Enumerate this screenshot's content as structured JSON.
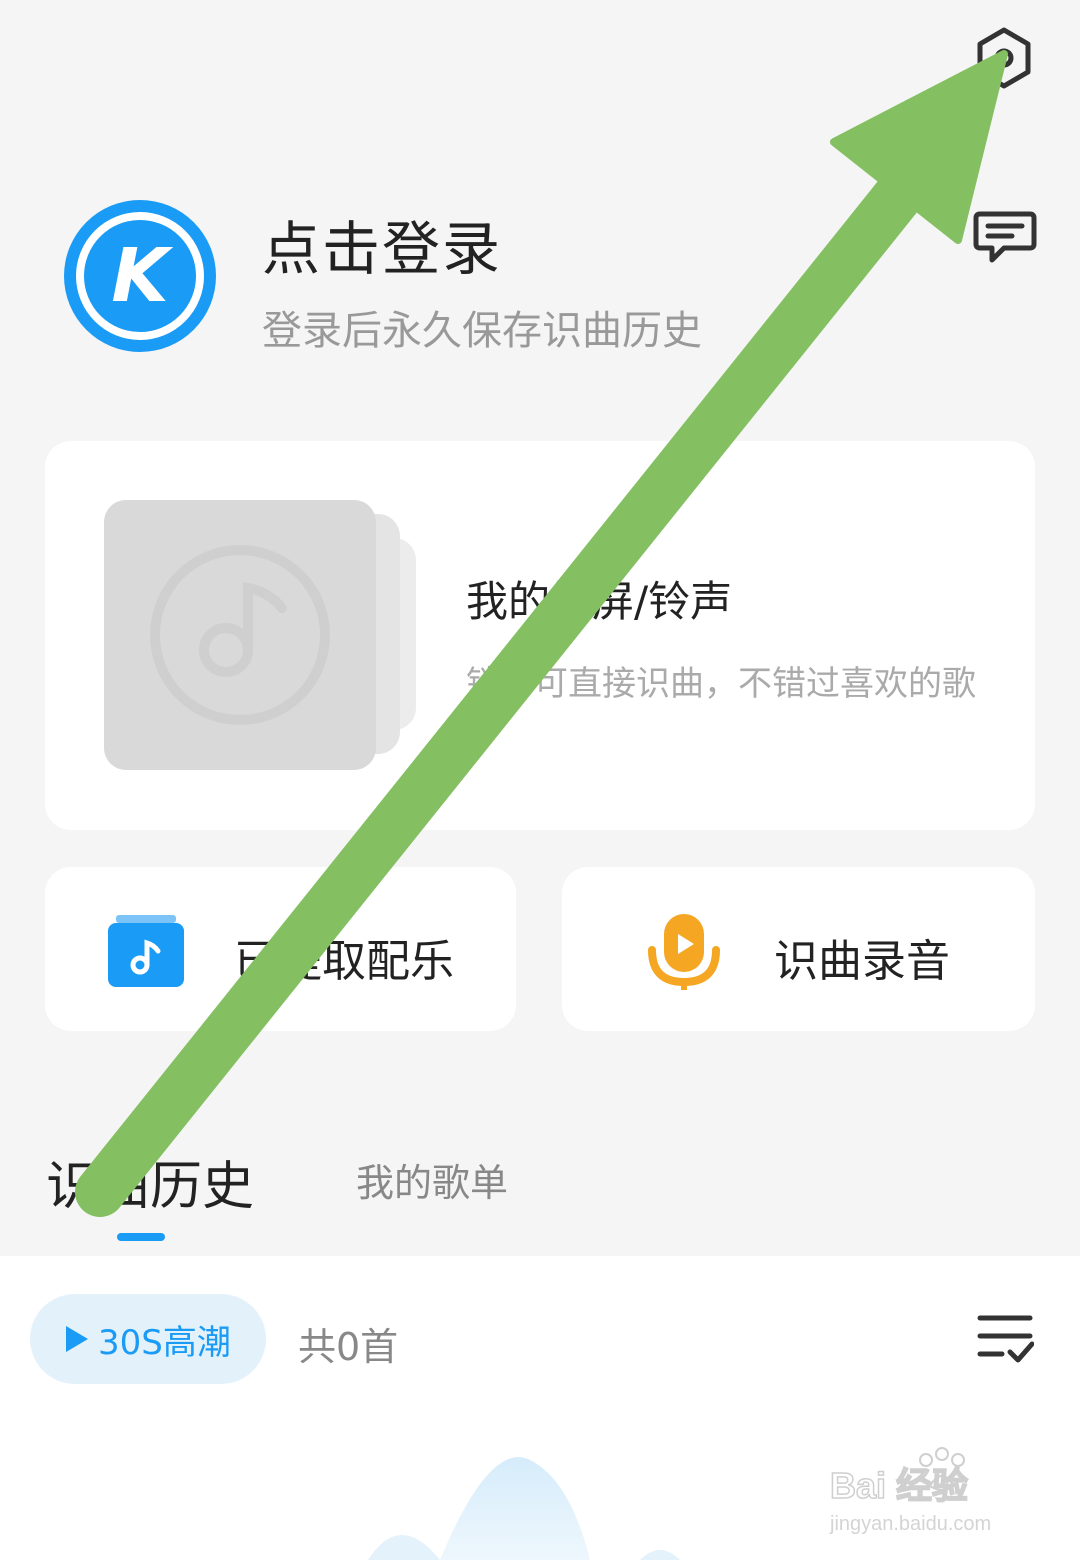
{
  "header": {
    "settings_icon": "settings-hexagon-icon",
    "feedback_icon": "feedback-chat-icon"
  },
  "profile": {
    "avatar_letter": "K",
    "title": "点击登录",
    "subtitle": "登录后永久保存识曲历史"
  },
  "ringtone_card": {
    "title": "我的锁屏/铃声",
    "description": "锁屏可直接识曲，不错过喜欢的歌",
    "cover_icon": "music-note-icon"
  },
  "actions": [
    {
      "label": "已提取配乐",
      "icon": "music-folder-icon",
      "color": "#1a9bf5"
    },
    {
      "label": "识曲录音",
      "icon": "microphone-icon",
      "color": "#f5a623"
    }
  ],
  "tabs": [
    {
      "label": "识曲历史",
      "active": true
    },
    {
      "label": "我的歌单",
      "active": false
    }
  ],
  "list": {
    "climax_button": "30S高潮",
    "count": "共0首",
    "sort_icon": "sort-check-icon"
  },
  "watermark": {
    "brand": "Bai 经验",
    "url": "jingyan.baidu.com"
  },
  "colors": {
    "accent": "#1a9bf5",
    "orange": "#f5a623",
    "arrow": "#84c062",
    "background": "#f5f5f5"
  }
}
